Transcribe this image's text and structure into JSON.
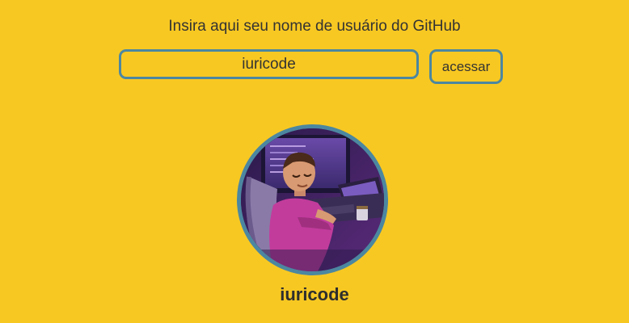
{
  "search": {
    "prompt": "Insira aqui seu nome de usuário do GitHub",
    "value": "iuricode",
    "button_label": "acessar"
  },
  "profile": {
    "username": "iuricode"
  },
  "colors": {
    "background": "#f8c822",
    "border": "#4c87a0",
    "text": "#333333"
  }
}
